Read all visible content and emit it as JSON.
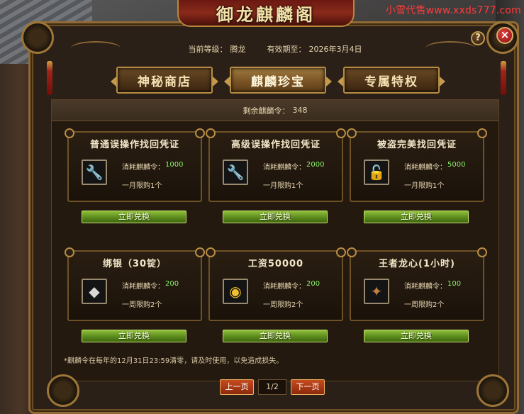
{
  "watermark": "小雪代售www.xxds777.com",
  "window": {
    "title": "御龙麒麟阁",
    "help_label": "?",
    "close_label": "×"
  },
  "header": {
    "level_label": "当前等级：",
    "level_value": "腾龙",
    "expiry_label": "有效期至：",
    "expiry_value": "2026年3月4日"
  },
  "tabs": [
    {
      "label": "神秘商店",
      "active": false
    },
    {
      "label": "麒麟珍宝",
      "active": true
    },
    {
      "label": "专属特权",
      "active": false
    }
  ],
  "tokens": {
    "label": "剩余麒麟令：",
    "value": "348"
  },
  "items": [
    {
      "title": "普通误操作找回凭证",
      "icon": "wrench-icon",
      "cost_label": "消耗麒麟令：",
      "cost": "1000",
      "limit": "一月限购1个",
      "button": "立即兑换"
    },
    {
      "title": "高级误操作找回凭证",
      "icon": "wrench-icon",
      "cost_label": "消耗麒麟令：",
      "cost": "2000",
      "limit": "一月限购1个",
      "button": "立即兑换"
    },
    {
      "title": "被盗完美找回凭证",
      "icon": "lock-icon",
      "cost_label": "消耗麒麟令：",
      "cost": "5000",
      "limit": "一月限购1个",
      "button": "立即兑换"
    },
    {
      "title": "绑银（30锭）",
      "icon": "silver-ingot-icon",
      "cost_label": "消耗麒麟令：",
      "cost": "200",
      "limit": "一周限购2个",
      "button": "立即兑换"
    },
    {
      "title": "工资50000",
      "icon": "gold-coins-icon",
      "cost_label": "消耗麒麟令：",
      "cost": "200",
      "limit": "一周限购2个",
      "button": "立即兑换"
    },
    {
      "title": "王者龙心(1小时)",
      "icon": "dragon-heart-icon",
      "cost_label": "消耗麒麟令：",
      "cost": "100",
      "limit": "一周限购2个",
      "button": "立即兑换"
    }
  ],
  "note": "*麒麟令在每年的12月31日23:59清零，请及时使用，以免造成损失。",
  "pager": {
    "prev_label": "上一页",
    "page": "1/2",
    "next_label": "下一页"
  },
  "colors": {
    "cost_value": "#8bf06a",
    "redeem_button": "#5f8f1e",
    "pager_button": "#c84a1e",
    "frame_gold": "#b88c44"
  }
}
